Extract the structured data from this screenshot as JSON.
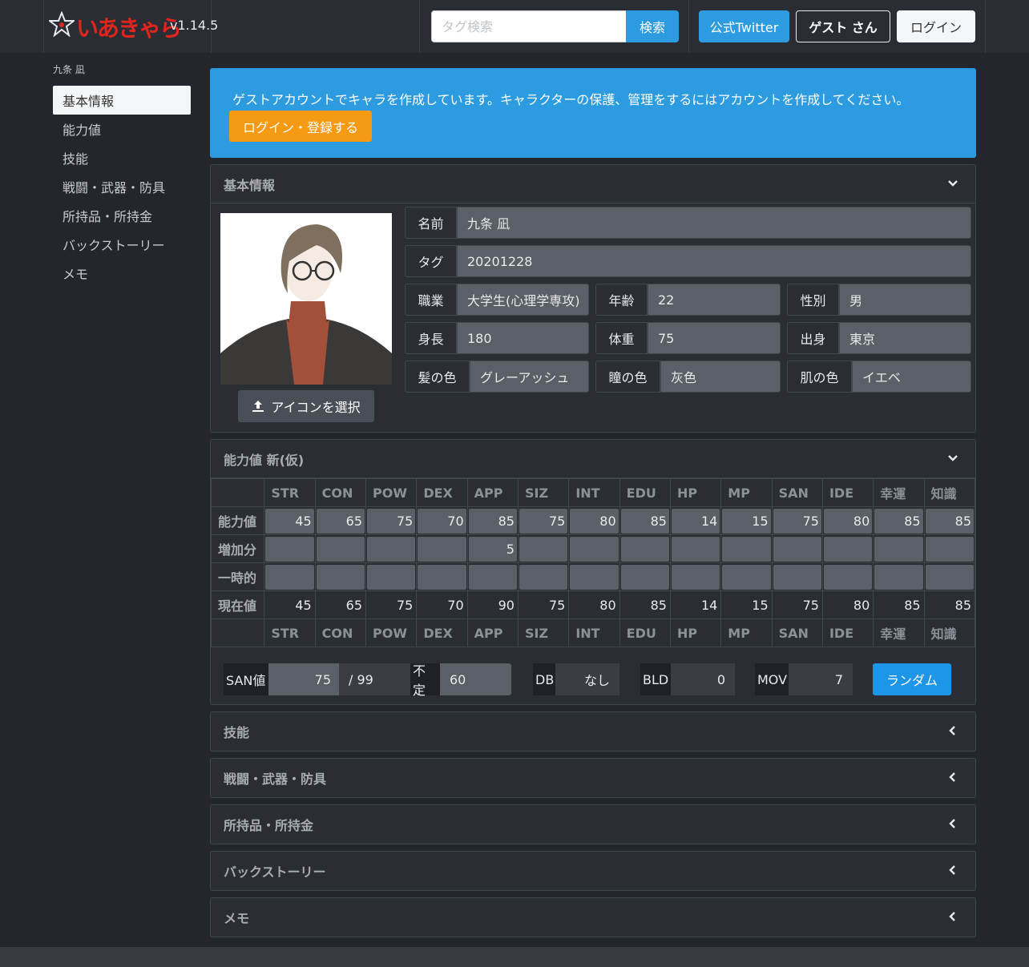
{
  "header": {
    "logo_text": "いあきゃら",
    "version": "v1.14.5",
    "search_placeholder": "タグ検索",
    "search_button": "検索",
    "twitter_button": "公式Twitter",
    "guest_button": "ゲスト さん",
    "login_button": "ログイン"
  },
  "sidebar": {
    "title": "九条 凪",
    "items": [
      "基本情報",
      "能力値",
      "技能",
      "戦闘・武器・防具",
      "所持品・所持金",
      "バックストーリー",
      "メモ"
    ],
    "active_index": 0
  },
  "alert": {
    "message": "ゲストアカウントでキャラを作成しています。キャラクターの保護、管理をするにはアカウントを作成してください。",
    "button": "ログイン・登録する"
  },
  "basic_info": {
    "heading": "基本情報",
    "icon_button": "アイコンを選択",
    "name_label": "名前",
    "name": "九条 凪",
    "tag_label": "タグ",
    "tag": "20201228",
    "job_label": "職業",
    "job": "大学生(心理学専攻)",
    "age_label": "年齢",
    "age": "22",
    "sex_label": "性別",
    "sex": "男",
    "height_label": "身長",
    "height": "180",
    "weight_label": "体重",
    "weight": "75",
    "origin_label": "出身",
    "origin": "東京",
    "hair_label": "髪の色",
    "hair": "グレーアッシュ",
    "eye_label": "瞳の色",
    "eye": "灰色",
    "skin_label": "肌の色",
    "skin": "イエベ"
  },
  "abilities": {
    "heading": "能力値 新(仮)",
    "columns": [
      "STR",
      "CON",
      "POW",
      "DEX",
      "APP",
      "SIZ",
      "INT",
      "EDU",
      "HP",
      "MP",
      "SAN",
      "IDE",
      "幸運",
      "知識"
    ],
    "rows": [
      {
        "label": "能力値",
        "values": [
          "45",
          "65",
          "75",
          "70",
          "85",
          "75",
          "80",
          "85",
          "14",
          "15",
          "75",
          "80",
          "85",
          "85"
        ]
      },
      {
        "label": "増加分",
        "values": [
          "",
          "",
          "",
          "",
          "5",
          "",
          "",
          "",
          "",
          "",
          "",
          "",
          "",
          ""
        ]
      },
      {
        "label": "一時的",
        "values": [
          "",
          "",
          "",
          "",
          "",
          "",
          "",
          "",
          "",
          "",
          "",
          "",
          "",
          ""
        ]
      },
      {
        "label": "現在値",
        "values": [
          "45",
          "65",
          "75",
          "70",
          "90",
          "75",
          "80",
          "85",
          "14",
          "15",
          "75",
          "80",
          "85",
          "85"
        ]
      }
    ],
    "san_label": "SAN値",
    "san_value": "75",
    "san_max": "/ 99",
    "indef_label": "不定",
    "indef_value": "60",
    "db_label": "DB",
    "db_value": "なし",
    "bld_label": "BLD",
    "bld_value": "0",
    "mov_label": "MOV",
    "mov_value": "7",
    "random_button": "ランダム"
  },
  "sections": {
    "skills": "技能",
    "combat": "戦闘・武器・防具",
    "items": "所持品・所持金",
    "backstory": "バックストーリー",
    "memo": "メモ"
  }
}
